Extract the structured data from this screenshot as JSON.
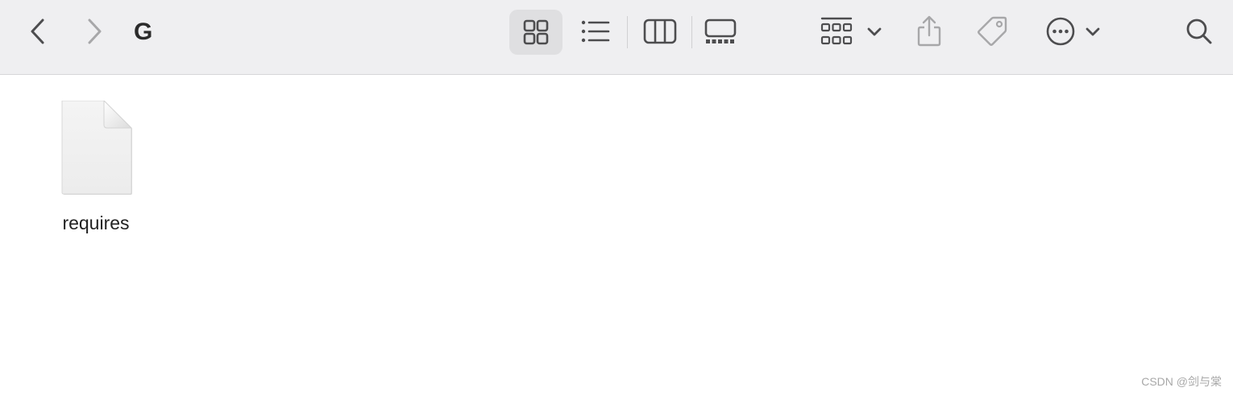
{
  "toolbar": {
    "folder_title": "G",
    "buttons": {
      "back": "chevron-left-icon",
      "forward": "chevron-right-icon",
      "view_icons": "icon-view-grid-icon",
      "view_list": "list-view-icon",
      "view_columns": "column-view-icon",
      "view_gallery": "gallery-view-icon",
      "group": "group-by-icon",
      "share": "share-icon",
      "tags": "tag-icon",
      "more": "ellipsis-circle-icon",
      "search": "search-icon"
    },
    "active_view": "icons"
  },
  "files": [
    {
      "name": "requires",
      "kind": "document-icon"
    }
  ],
  "watermark": "CSDN @剑与棠",
  "colors": {
    "toolbar_bg": "#efeff1",
    "active_view_bg": "#dfdfe1",
    "icon": "#4d4d4f",
    "icon_disabled": "#a7a7a9"
  }
}
